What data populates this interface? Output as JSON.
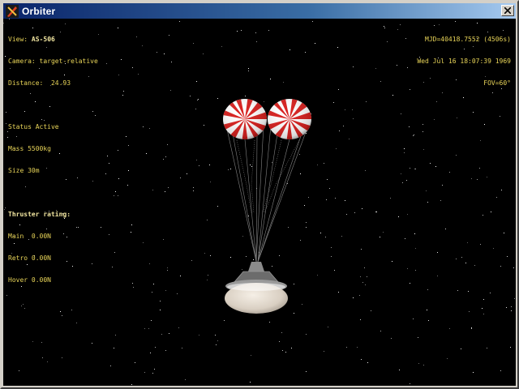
{
  "window": {
    "title": "Orbiter",
    "close_label": "×"
  },
  "hud_left": {
    "view_label": "View:",
    "view_value": "AS-506",
    "camera_line": "Camera: target-relative",
    "distance_line": "Distance:  24.93",
    "status_line": "Status Active",
    "mass_line": "Mass 5500kg",
    "size_line": "Size 30m",
    "thruster_heading": "Thruster rating:",
    "main_line": "Main  0.00N",
    "retro_line": "Retro 0.00N",
    "hover_line": "Hover 0.00N"
  },
  "hud_right": {
    "mjd_line": "MJD=40418.7552 (4506s)",
    "date_line": "Wed Jul 16 18:07:39 1969",
    "fov_line": "FOV=60°"
  },
  "colors": {
    "hud_text": "#e8d458",
    "sky": "#000000",
    "chute_red": "#d8201e",
    "chute_white": "#ffffff",
    "capsule_shield": "#e8dfd2"
  },
  "icons": {
    "app": "orbiter-logo-icon",
    "close": "close-icon"
  }
}
